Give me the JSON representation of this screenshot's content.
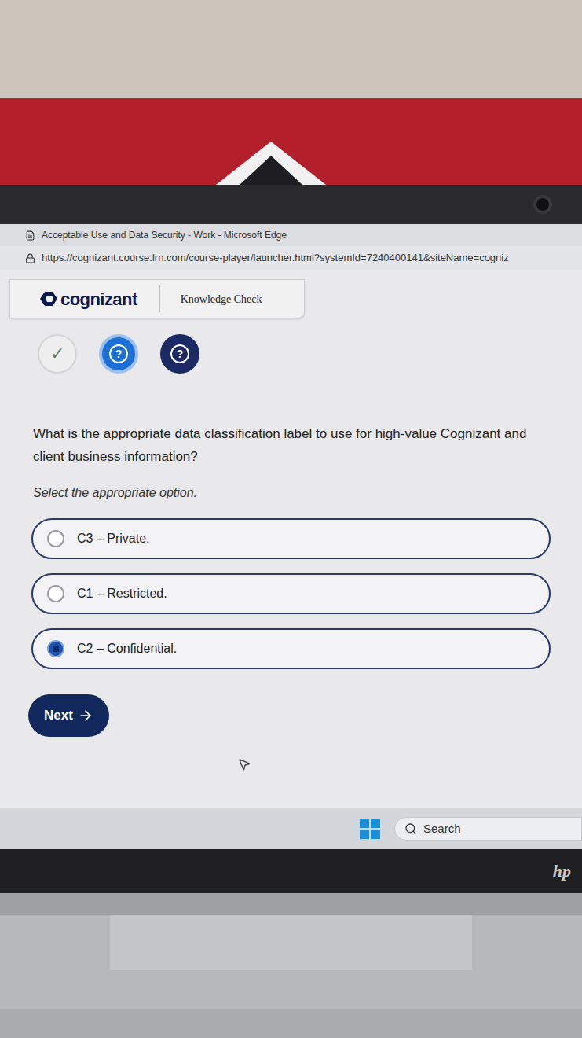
{
  "browser": {
    "title": "Acceptable Use and Data Security - Work - Microsoft Edge",
    "url": "https://cognizant.course.lrn.com/course-player/launcher.html?systemId=7240400141&siteName=cogniz"
  },
  "header": {
    "brand": "cognizant",
    "section": "Knowledge Check"
  },
  "steps": [
    {
      "glyph": "✓",
      "completed": true,
      "selected": false
    },
    {
      "glyph": "?",
      "completed": false,
      "selected": true
    },
    {
      "glyph": "?",
      "completed": false,
      "selected": false
    }
  ],
  "question": {
    "text": "What is the appropriate data classification label to use for high-value Cognizant and client business information?",
    "instruction": "Select the appropriate option."
  },
  "options": [
    {
      "label": "C3 – Private.",
      "selected": false
    },
    {
      "label": "C1 – Restricted.",
      "selected": false
    },
    {
      "label": "C2 – Confidential.",
      "selected": true
    }
  ],
  "next_button": {
    "label": "Next"
  },
  "taskbar": {
    "search_placeholder": "Search"
  },
  "laptop": {
    "logo": "hp"
  }
}
